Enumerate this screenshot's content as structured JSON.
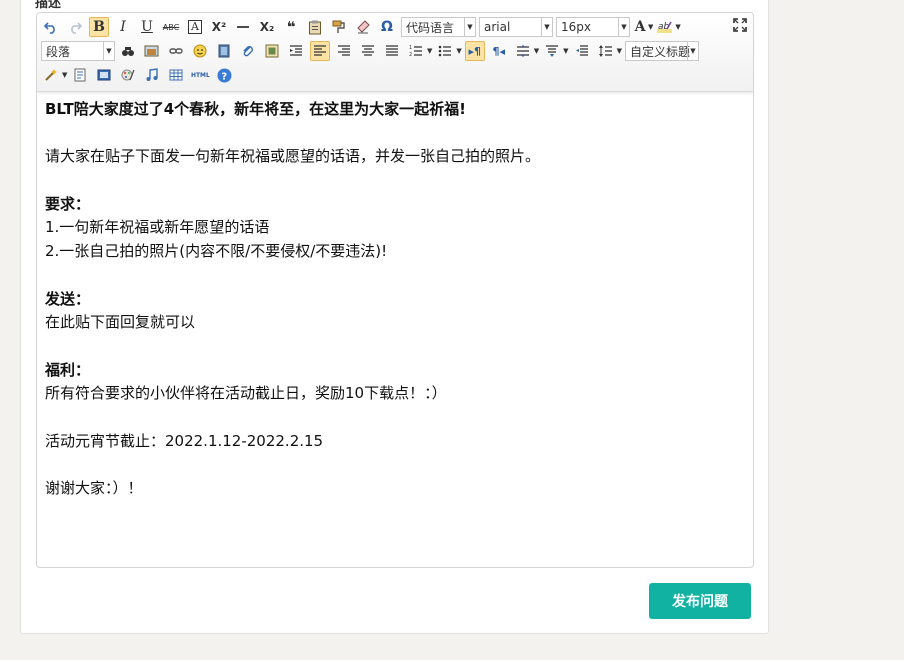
{
  "section_label": "描述",
  "toolbar": {
    "code_language_select": "代码语言",
    "font_family_select": "arial",
    "font_size_select": "16px",
    "paragraph_select": "段落",
    "custom_heading_select": "自定义标题",
    "html_label": "HTML",
    "bold_label": "B",
    "italic_label": "I",
    "underline_label": "U",
    "strikethrough_label": "ABC",
    "fontcolor_label": "A",
    "superscript_label": "X²",
    "subscript_label": "X₂",
    "quote_label": "❝",
    "omega_label": "Ω",
    "ltr_label": "▸¶",
    "rtl_label": "¶◂"
  },
  "content": {
    "line1": "BLT陪大家度过了4个春秋，新年将至，在这里为大家一起祈福!",
    "line2": "请大家在贴子下面发一句新年祝福或愿望的话语，并发一张自己拍的照片。",
    "req_title": "要求：",
    "req_1": "1.一句新年祝福或新年愿望的话语",
    "req_2": "2.一张自己拍的照片(内容不限/不要侵权/不要违法)!",
    "send_title": "发送：",
    "send_text": "在此贴下面回复就可以",
    "benefit_title": "福利：",
    "benefit_text": "所有符合要求的小伙伴将在活动截止日，奖励10下载点！：）",
    "deadline": "活动元宵节截止：2022.1.12-2022.2.15",
    "thanks": "谢谢大家：）！"
  },
  "actions": {
    "publish_label": "发布问题"
  },
  "colors": {
    "accent": "#12b2a3",
    "active_button": "#fbe3a5"
  }
}
